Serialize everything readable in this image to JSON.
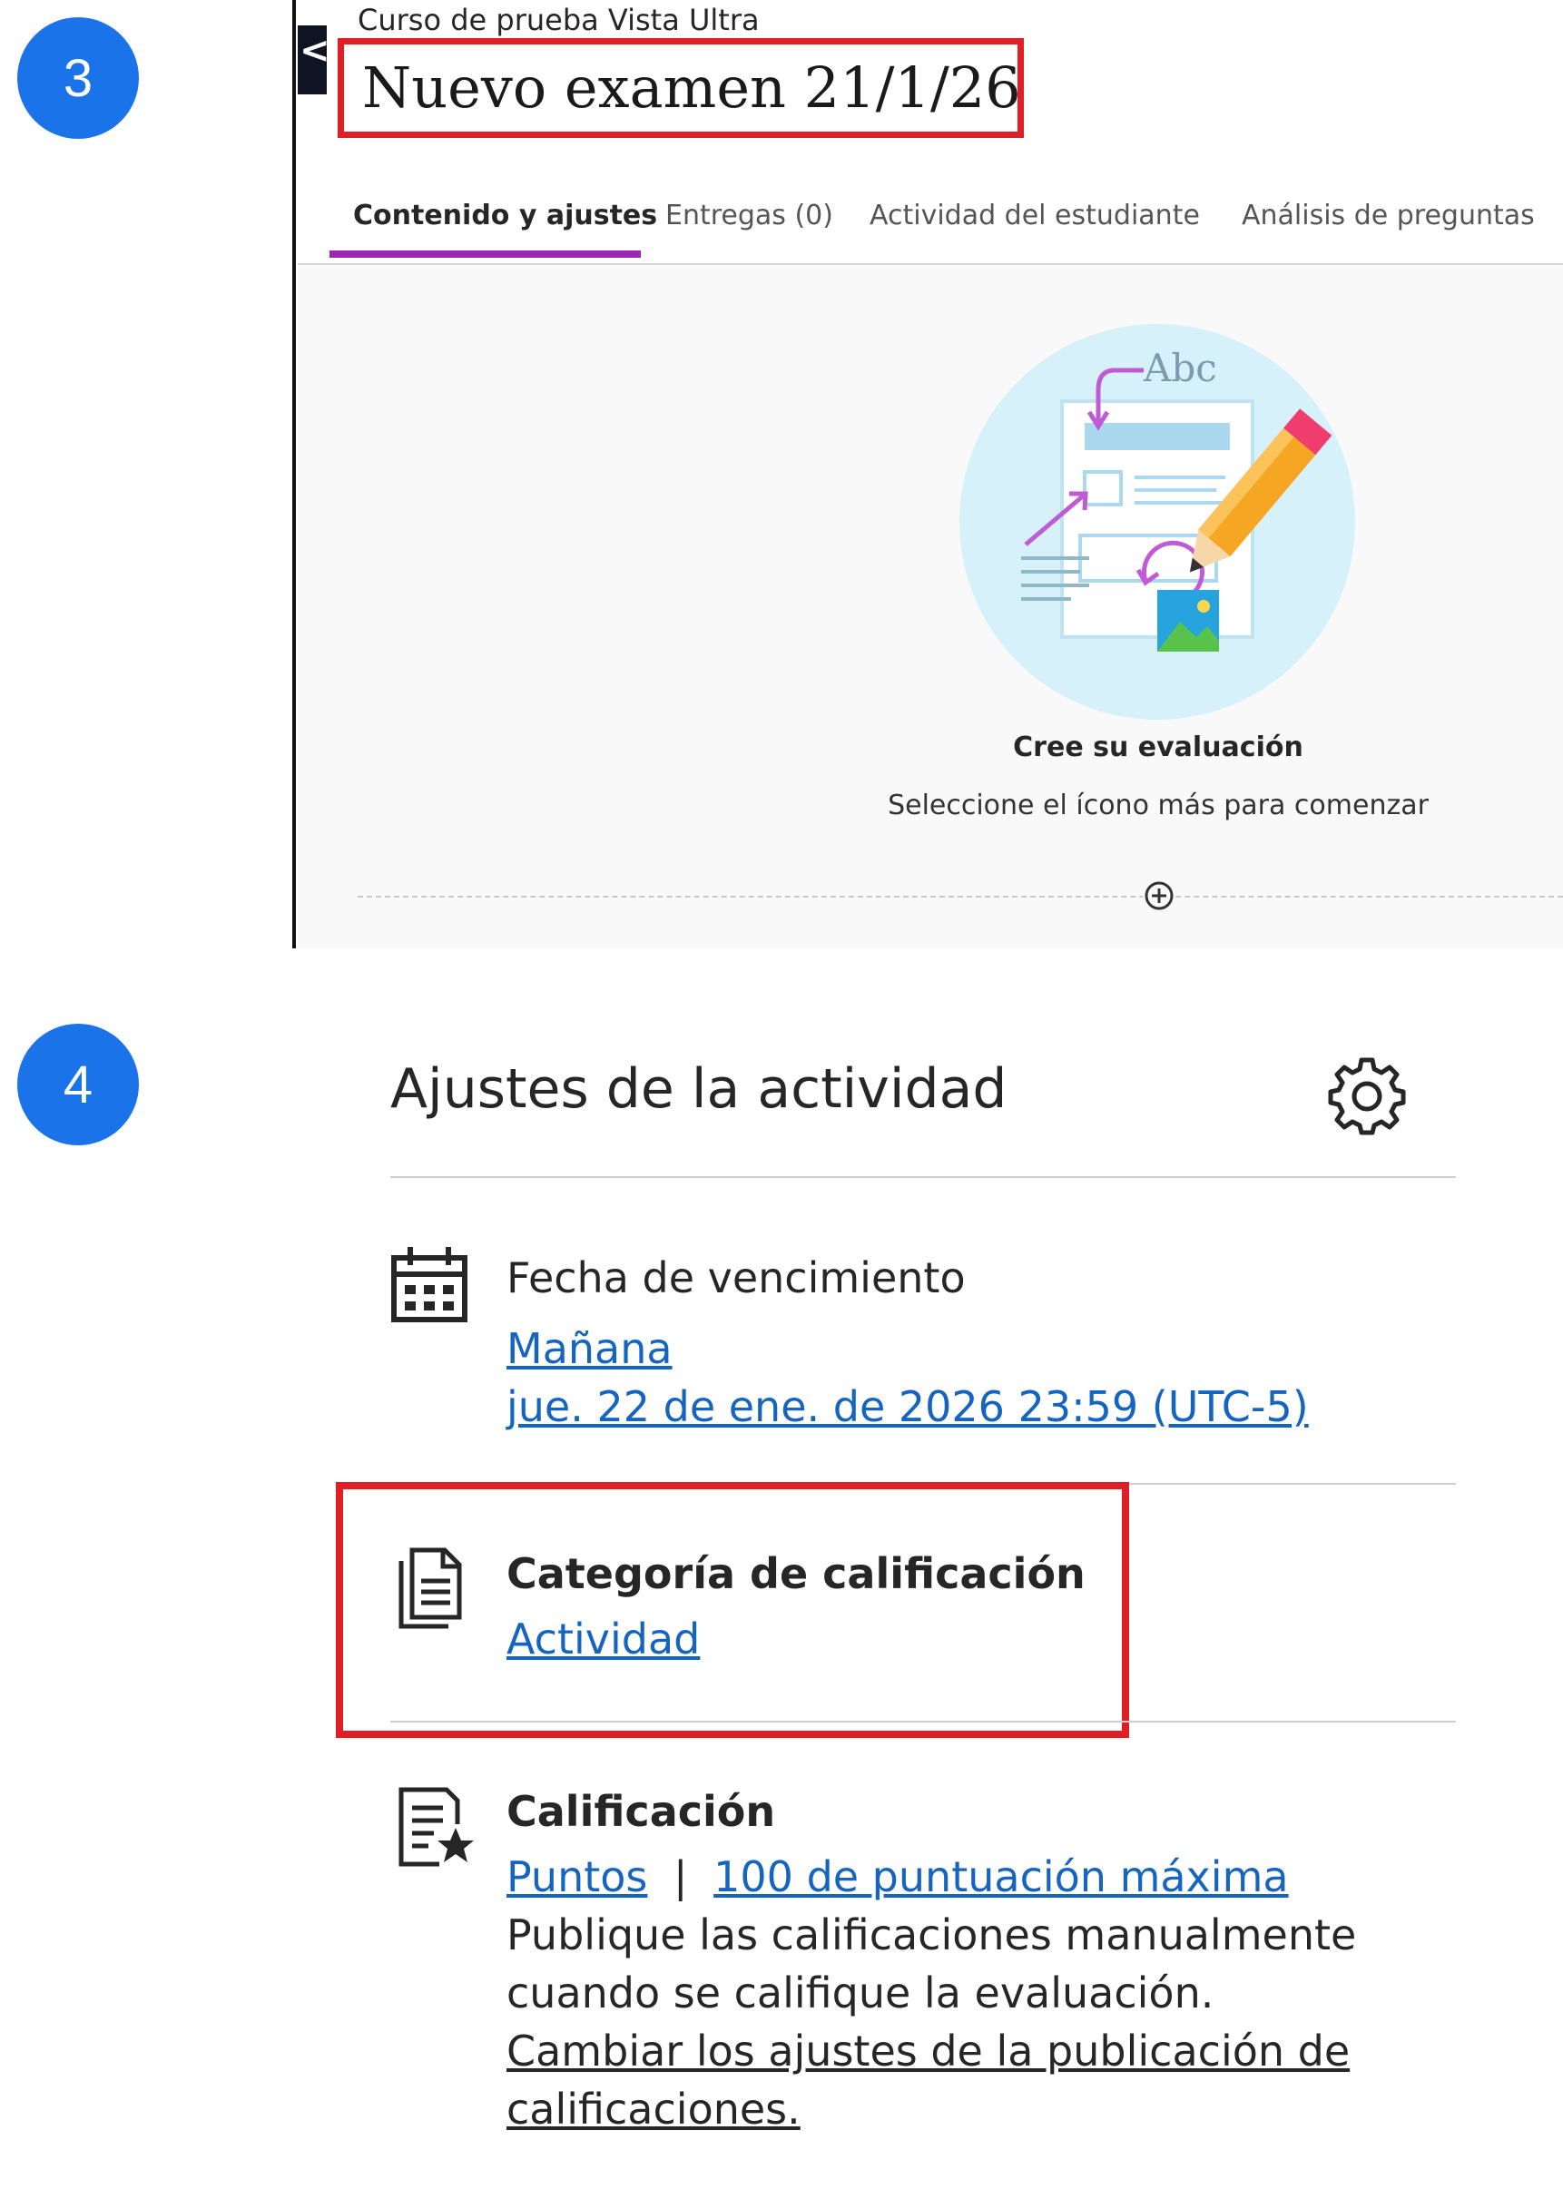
{
  "badges": {
    "step3": "3",
    "step4": "4"
  },
  "panel3": {
    "collapse_glyph": "<",
    "course_name": "Curso de prueba Vista Ultra",
    "exam_title": "Nuevo examen 21/1/26",
    "tabs": [
      {
        "label": "Contenido y ajustes",
        "active": true
      },
      {
        "label": "Entregas (0)",
        "active": false
      },
      {
        "label": "Actividad del estudiante",
        "active": false
      },
      {
        "label": "Análisis de preguntas",
        "active": false
      }
    ],
    "illustration_text": "Abc",
    "empty_title": "Cree su evaluación",
    "empty_subtitle": "Seleccione el ícono más para comenzar",
    "add_icon": "plus-circle-icon"
  },
  "panel4": {
    "title": "Ajustes de la actividad",
    "settings_icon": "gear-icon",
    "due_date": {
      "icon": "calendar-icon",
      "label": "Fecha de vencimiento",
      "relative": "Mañana",
      "absolute": "jue. 22 de ene. de 2026 23:59 (UTC-5)"
    },
    "grade_category": {
      "icon": "document-icon",
      "label": "Categoría de calificación",
      "value": "Actividad"
    },
    "grading": {
      "icon": "grading-star-icon",
      "label": "Calificación",
      "points_link": "Puntos",
      "separator": "|",
      "max_score_link": "100 de puntuación máxima",
      "description_line1": "Publique las calificaciones manualmente",
      "description_line2": "cuando se califique la evaluación.",
      "change_link_line1": "Cambiar los ajustes de la publicación de",
      "change_link_line2": "calificaciones."
    }
  },
  "colors": {
    "badge": "#1a73e8",
    "highlight": "#e01e26",
    "tab_underline": "#9c27b0",
    "link": "#1565c0"
  }
}
